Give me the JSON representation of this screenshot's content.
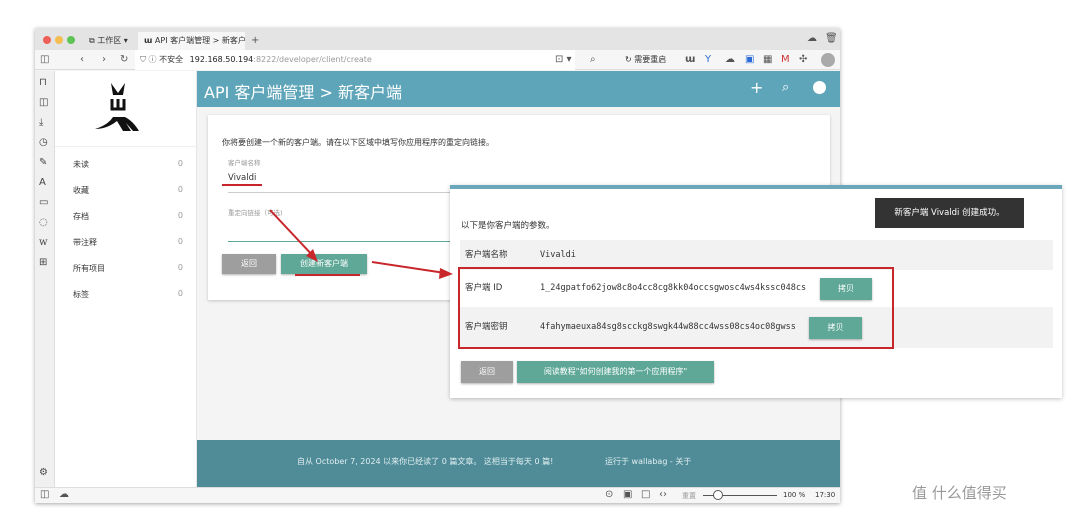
{
  "browser": {
    "workspace_label": "工作区",
    "tab_title": "API 客户端管理 > 新客户端",
    "insecure_label": "不安全",
    "url_host": "192.168.50.194",
    "url_path": ":8222/developer/client/create",
    "restart_label": "需要重启"
  },
  "sidebar": {
    "items": [
      {
        "label": "未读",
        "count": "0"
      },
      {
        "label": "收藏",
        "count": "0"
      },
      {
        "label": "存档",
        "count": "0"
      },
      {
        "label": "带注释",
        "count": "0"
      },
      {
        "label": "所有项目",
        "count": "0"
      },
      {
        "label": "标签",
        "count": "0"
      }
    ]
  },
  "header": {
    "title": "API 客户端管理 > 新客户端"
  },
  "form": {
    "intro": "你将要创建一个新的客户端。请在以下区域中填写你应用程序的重定向链接。",
    "name_label": "客户端名称",
    "name_value": "Vivaldi",
    "redirect_label": "重定向链接（可选)",
    "back_label": "返回",
    "create_label": "创建新客户端"
  },
  "result": {
    "intro": "以下是你客户端的参数。",
    "rows": [
      {
        "key": "客户端名称",
        "value": "Vivaldi"
      },
      {
        "key": "客户端 ID",
        "value": "1_24gpatfo62jow8c8o4cc8cg8kk04occsgwosc4ws4kssc048cs",
        "copy": "拷贝"
      },
      {
        "key": "客户端密钥",
        "value": "4fahymaeuxa84sg8scckg8swgk44w88cc4wss08cs4oc08gwss",
        "copy": "拷贝"
      }
    ],
    "back_label": "返回",
    "tutorial_label": "阅读教程\"如何创建我的第一个应用程序\""
  },
  "toast": "新客户端 Vivaldi 创建成功。",
  "footer": {
    "stats": "自从 October 7, 2024 以来你已经读了 0 篇文章。 这相当于每天 0 篇!",
    "powered": "运行于 wallabag - 关于"
  },
  "statusbar": {
    "reset_label": "重置",
    "zoom": "100 %",
    "time": "17:30"
  },
  "watermark": "值 什么值得买"
}
